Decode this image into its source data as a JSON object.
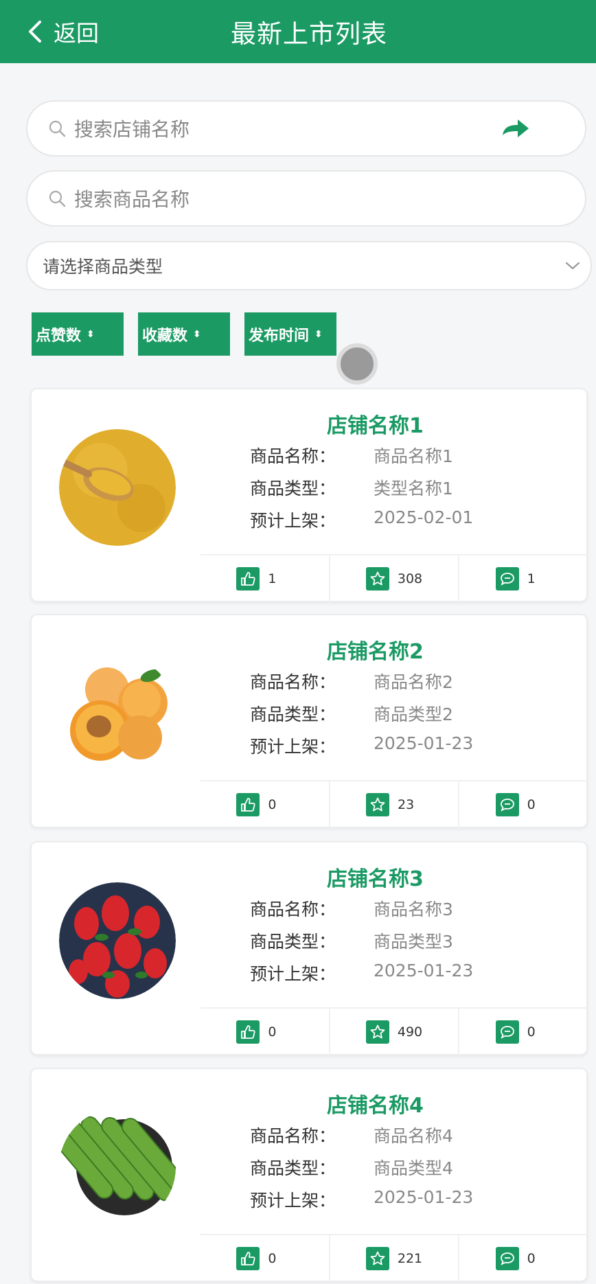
{
  "header": {
    "back_label": "返回",
    "title": "最新上市列表"
  },
  "search_shop": {
    "placeholder": "搜索店铺名称"
  },
  "search_product": {
    "placeholder": "搜索商品名称"
  },
  "type_select": {
    "placeholder": "请选择商品类型"
  },
  "sort": {
    "likes": "点赞数",
    "favorites": "收藏数",
    "publish_time": "发布时间",
    "arrows": "⬍"
  },
  "labels": {
    "name": "商品名称：",
    "type": "商品类型：",
    "release": "预计上架："
  },
  "items": [
    {
      "shop": "店铺名称1",
      "name": "商品名称1",
      "type": "类型名称1",
      "release": "2025-02-01",
      "likes": "1",
      "favorites": "308",
      "comments": "1",
      "image": "millet"
    },
    {
      "shop": "店铺名称2",
      "name": "商品名称2",
      "type": "商品类型2",
      "release": "2025-01-23",
      "likes": "0",
      "favorites": "23",
      "comments": "0",
      "image": "apricot"
    },
    {
      "shop": "店铺名称3",
      "name": "商品名称3",
      "type": "商品类型3",
      "release": "2025-01-23",
      "likes": "0",
      "favorites": "490",
      "comments": "0",
      "image": "strawberry"
    },
    {
      "shop": "店铺名称4",
      "name": "商品名称4",
      "type": "商品类型4",
      "release": "2025-01-23",
      "likes": "0",
      "favorites": "221",
      "comments": "0",
      "image": "cucumber"
    }
  ],
  "colors": {
    "accent": "#1b9a64",
    "background": "#f5f6f8"
  }
}
